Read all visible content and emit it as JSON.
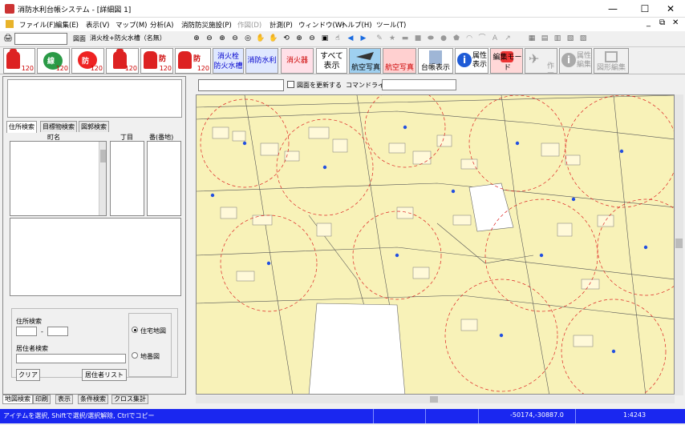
{
  "window": {
    "title": "消防水利台帳システム - [詳細図 1]",
    "controls": [
      "—",
      "☐",
      "✕"
    ]
  },
  "menu": {
    "items": [
      "ファイル(F)",
      "編集(E)",
      "表示(V)",
      "マップ(M)",
      "分析(A)",
      "消防防災施設(P)",
      "作図(D)",
      "計測(P)",
      "ウィンドウ(W)",
      "ヘルプ(H)",
      "ツール(T)"
    ],
    "mdi_controls": [
      "_",
      "⧉",
      "✕"
    ]
  },
  "toolbar1": {
    "layer_label": "図面",
    "layer_value": "消火栓+防火水槽（名無）"
  },
  "toolbar2": {
    "buttons": [
      {
        "chip": "",
        "badge": "120"
      },
      {
        "chip": "線",
        "badge": "120"
      },
      {
        "chip": "防",
        "badge": "120"
      },
      {
        "chip": "",
        "badge": "120"
      },
      {
        "chip": "防",
        "badge": "120"
      },
      {
        "chip": "防",
        "badge": "120"
      }
    ],
    "hydrant_tank": "消火栓\n防火水槽",
    "fire_water": "消防水利",
    "extinguisher": "消火器",
    "show_all": "すべて\n表示",
    "aerial": "航空写真",
    "aerial2": "航空写真",
    "ledger": "台帳表示",
    "attr_show": "属性\n表示",
    "edit_mode": "編集モード",
    "draw": "作図",
    "attr_edit": "属性\n編集",
    "map_edit": "図形編集"
  },
  "left": {
    "tabs": [
      "住所検索",
      "目標物検索",
      "図郭検索"
    ],
    "col_town": "町名",
    "col_chome": "丁目",
    "col_ban": "番(番地)",
    "address_label": "住所検索",
    "dash": "-",
    "resident_label": "居住者検索",
    "clear_btn": "クリア",
    "resident_list_btn": "居住者リスト",
    "radio_house": "住宅地図",
    "radio_lot": "地番図",
    "bottom_tabs": [
      "地図検索",
      "印刷",
      "表示",
      "条件検索",
      "クロス集計"
    ]
  },
  "mapbar": {
    "refresh_label": "図面を更新する",
    "command_label": "コマンドライン:"
  },
  "status": {
    "message": "アイテムを選択, Shiftで選択/選択解除, Ctrlでコピー",
    "coords": "-50174,-30887.0",
    "scale": "1:4243"
  }
}
